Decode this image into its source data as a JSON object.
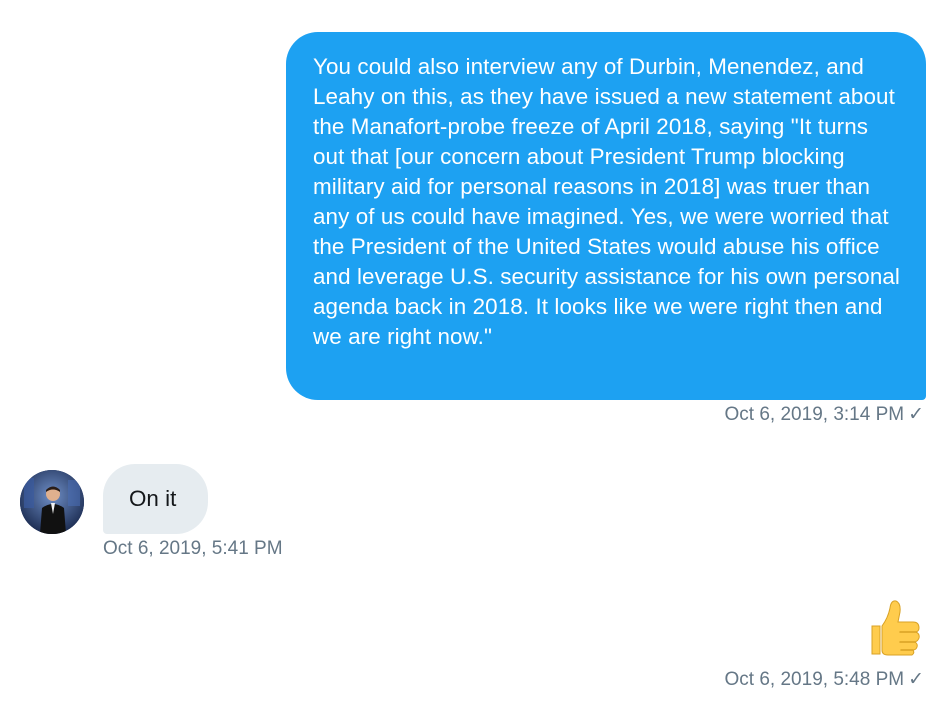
{
  "messages": [
    {
      "direction": "outgoing",
      "text": "You could also interview any of Durbin, Menendez, and Leahy on this, as they have issued a new statement about the Manafort-probe freeze of April 2018, saying \"It turns out that [our concern about President Trump blocking military aid for personal reasons in 2018] was truer than any of us could have imagined. Yes, we were worried that the President of the United States would abuse his office and leverage U.S. security assistance for his own personal agenda back in 2018. It looks like we were right then and we are right now.\"",
      "timestamp": "Oct 6, 2019, 3:14 PM",
      "status_icon": "checkmark-icon"
    },
    {
      "direction": "incoming",
      "text": "On it",
      "timestamp": "Oct 6, 2019, 5:41 PM",
      "avatar_icon": "user-avatar"
    },
    {
      "direction": "outgoing",
      "emoji": "thumbs-up-icon",
      "timestamp": "Oct 6, 2019, 5:48 PM",
      "status_icon": "checkmark-icon"
    }
  ],
  "symbols": {
    "check": "✓"
  },
  "colors": {
    "outgoing_bubble": "#1da1f2",
    "incoming_bubble": "#e6ecf0",
    "meta_text": "#657786",
    "thumb": "#ffcc4d"
  }
}
